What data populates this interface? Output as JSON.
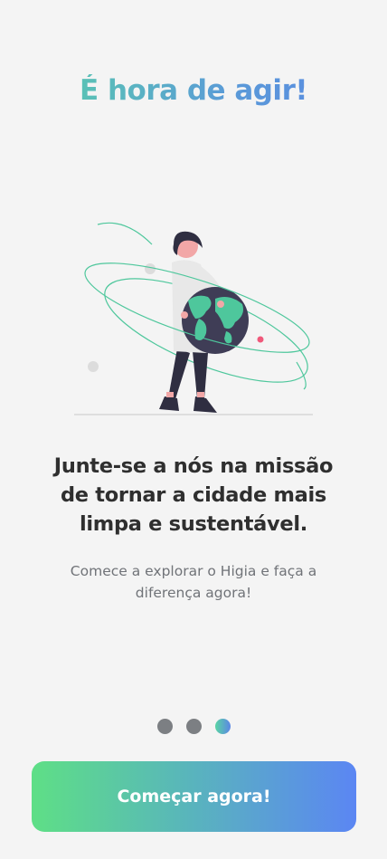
{
  "onboarding": {
    "headline": "É hora de agir!",
    "mission_line_1": "Junte-se a nós na missão",
    "mission_line_2": "de tornar a cidade mais",
    "mission_line_3": "limpa e sustentável.",
    "subtitle_line_1": "Comece a explorar o Higia e faça a",
    "subtitle_line_2": "diferença agora!",
    "illustration_icon": "woman-holding-globe-illustration",
    "pagination": {
      "total_pages": 3,
      "current_page": 3
    },
    "cta_label": "Começar agora!"
  },
  "colors": {
    "background": "#f4f4f4",
    "gradient_start": "#5ad5a4",
    "gradient_end": "#5b86e5",
    "text_dark": "#2f2f2f",
    "text_muted": "#707378",
    "dot_inactive": "#7c7f83"
  }
}
